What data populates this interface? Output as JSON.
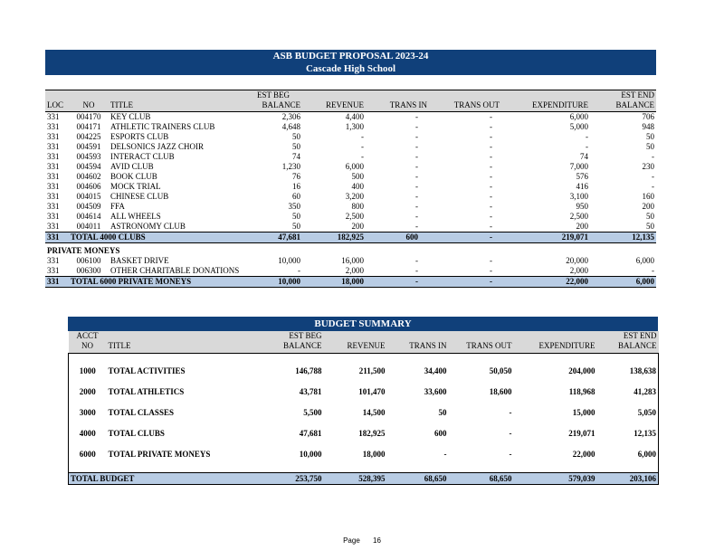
{
  "header": {
    "title": "ASB BUDGET PROPOSAL 2023-24",
    "subtitle": "Cascade High School"
  },
  "detail": {
    "columns": {
      "loc": "LOC",
      "no": "NO",
      "title": "TITLE",
      "est_beg_1": "EST BEG",
      "est_beg_2": "BALANCE",
      "revenue": "REVENUE",
      "trans_in": "TRANS IN",
      "trans_out": "TRANS OUT",
      "expenditure": "EXPENDITURE",
      "est_end_1": "EST END",
      "est_end_2": "BALANCE"
    },
    "clubs": [
      {
        "loc": "331",
        "no": "004170",
        "title": "KEY CLUB",
        "beg": "2,306",
        "rev": "4,400",
        "tin": "-",
        "tout": "-",
        "exp": "6,000",
        "end": "706"
      },
      {
        "loc": "331",
        "no": "004171",
        "title": "ATHLETIC TRAINERS CLUB",
        "beg": "4,648",
        "rev": "1,300",
        "tin": "-",
        "tout": "-",
        "exp": "5,000",
        "end": "948"
      },
      {
        "loc": "331",
        "no": "004225",
        "title": "ESPORTS CLUB",
        "beg": "50",
        "rev": "-",
        "tin": "-",
        "tout": "-",
        "exp": "-",
        "end": "50"
      },
      {
        "loc": "331",
        "no": "004591",
        "title": "DELSONICS JAZZ CHOIR",
        "beg": "50",
        "rev": "-",
        "tin": "-",
        "tout": "-",
        "exp": "-",
        "end": "50"
      },
      {
        "loc": "331",
        "no": "004593",
        "title": "INTERACT CLUB",
        "beg": "74",
        "rev": "-",
        "tin": "-",
        "tout": "-",
        "exp": "74",
        "end": "-"
      },
      {
        "loc": "331",
        "no": "004594",
        "title": "AVID CLUB",
        "beg": "1,230",
        "rev": "6,000",
        "tin": "-",
        "tout": "-",
        "exp": "7,000",
        "end": "230"
      },
      {
        "loc": "331",
        "no": "004602",
        "title": "BOOK CLUB",
        "beg": "76",
        "rev": "500",
        "tin": "-",
        "tout": "-",
        "exp": "576",
        "end": "-"
      },
      {
        "loc": "331",
        "no": "004606",
        "title": "MOCK TRIAL",
        "beg": "16",
        "rev": "400",
        "tin": "-",
        "tout": "-",
        "exp": "416",
        "end": "-"
      },
      {
        "loc": "331",
        "no": "004015",
        "title": "CHINESE CLUB",
        "beg": "60",
        "rev": "3,200",
        "tin": "-",
        "tout": "-",
        "exp": "3,100",
        "end": "160"
      },
      {
        "loc": "331",
        "no": "004509",
        "title": "FFA",
        "beg": "350",
        "rev": "800",
        "tin": "-",
        "tout": "-",
        "exp": "950",
        "end": "200"
      },
      {
        "loc": "331",
        "no": "004614",
        "title": "ALL WHEELS",
        "beg": "50",
        "rev": "2,500",
        "tin": "-",
        "tout": "-",
        "exp": "2,500",
        "end": "50"
      },
      {
        "loc": "331",
        "no": "004011",
        "title": "ASTRONOMY CLUB",
        "beg": "50",
        "rev": "200",
        "tin": "-",
        "tout": "-",
        "exp": "200",
        "end": "50"
      }
    ],
    "clubs_total": {
      "loc": "331",
      "label": "TOTAL 4000 CLUBS",
      "beg": "47,681",
      "rev": "182,925",
      "tin": "600",
      "tout": "-",
      "exp": "219,071",
      "end": "12,135"
    },
    "private_heading": "PRIVATE MONEYS",
    "private": [
      {
        "loc": "331",
        "no": "006100",
        "title": "BASKET DRIVE",
        "beg": "10,000",
        "rev": "16,000",
        "tin": "-",
        "tout": "-",
        "exp": "20,000",
        "end": "6,000"
      },
      {
        "loc": "331",
        "no": "006300",
        "title": "OTHER CHARITABLE DONATIONS",
        "beg": "-",
        "rev": "2,000",
        "tin": "-",
        "tout": "-",
        "exp": "2,000",
        "end": "-"
      }
    ],
    "private_total": {
      "loc": "331",
      "label": "TOTAL 6000 PRIVATE MONEYS",
      "beg": "10,000",
      "rev": "18,000",
      "tin": "-",
      "tout": "-",
      "exp": "22,000",
      "end": "6,000"
    }
  },
  "summary": {
    "title": "BUDGET SUMMARY",
    "columns": {
      "acct_1": "ACCT",
      "acct_2": "NO",
      "title": "TITLE",
      "est_beg_1": "EST BEG",
      "est_beg_2": "BALANCE",
      "revenue": "REVENUE",
      "trans_in": "TRANS IN",
      "trans_out": "TRANS OUT",
      "expenditure": "EXPENDITURE",
      "est_end_1": "EST END",
      "est_end_2": "BALANCE"
    },
    "rows": [
      {
        "no": "1000",
        "title": "TOTAL ACTIVITIES",
        "beg": "146,788",
        "rev": "211,500",
        "tin": "34,400",
        "tout": "50,050",
        "exp": "204,000",
        "end": "138,638"
      },
      {
        "no": "2000",
        "title": "TOTAL ATHLETICS",
        "beg": "43,781",
        "rev": "101,470",
        "tin": "33,600",
        "tout": "18,600",
        "exp": "118,968",
        "end": "41,283"
      },
      {
        "no": "3000",
        "title": "TOTAL CLASSES",
        "beg": "5,500",
        "rev": "14,500",
        "tin": "50",
        "tout": "-",
        "exp": "15,000",
        "end": "5,050"
      },
      {
        "no": "4000",
        "title": "TOTAL CLUBS",
        "beg": "47,681",
        "rev": "182,925",
        "tin": "600",
        "tout": "-",
        "exp": "219,071",
        "end": "12,135"
      },
      {
        "no": "6000",
        "title": "TOTAL PRIVATE MONEYS",
        "beg": "10,000",
        "rev": "18,000",
        "tin": "-",
        "tout": "-",
        "exp": "22,000",
        "end": "6,000"
      }
    ],
    "total": {
      "label": "TOTAL BUDGET",
      "beg": "253,750",
      "rev": "528,395",
      "tin": "68,650",
      "tout": "68,650",
      "exp": "579,039",
      "end": "203,106"
    }
  },
  "footer": {
    "page_label": "Page",
    "page_number": "16"
  }
}
